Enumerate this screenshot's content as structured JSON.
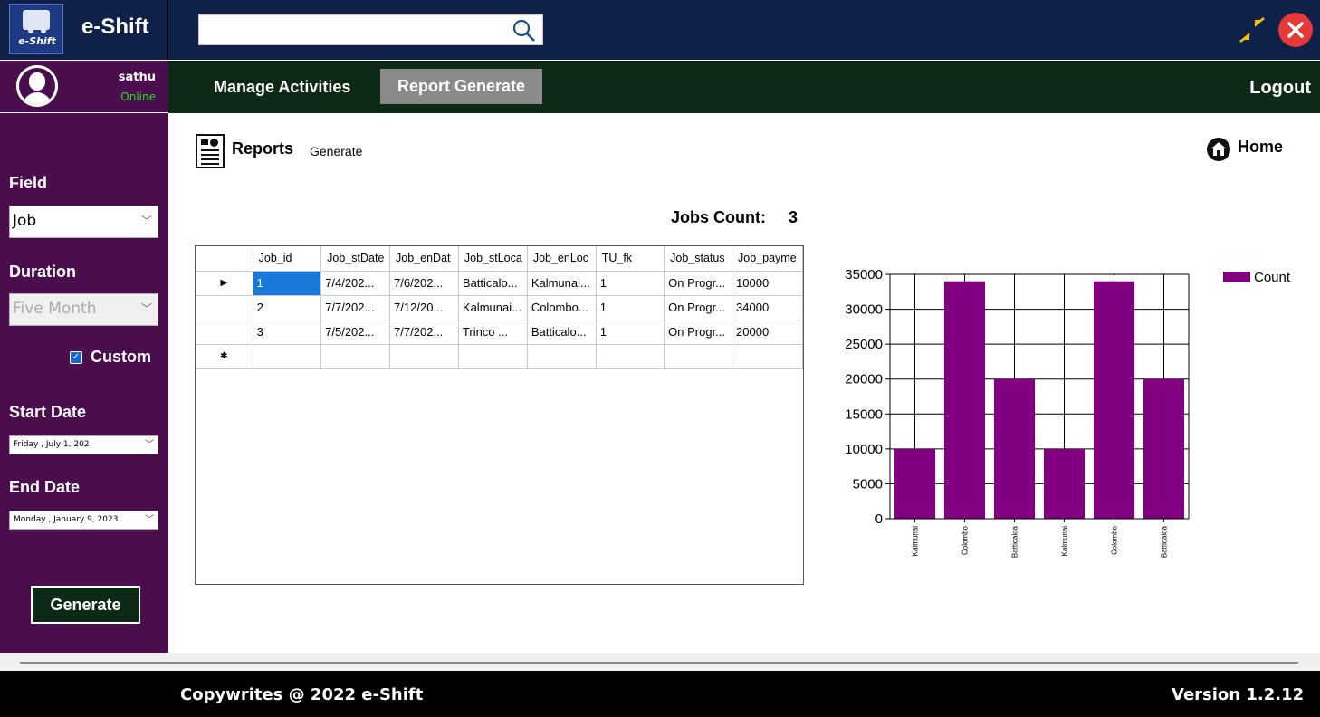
{
  "app": {
    "title": "e-Shift",
    "logo_text": "e-Shift"
  },
  "user": {
    "name": "sathu",
    "status": "Online"
  },
  "nav": {
    "manage": "Manage Activities",
    "report": "Report Generate",
    "logout": "Logout"
  },
  "sidebar": {
    "field_label": "Field",
    "field_value": "Job",
    "duration_label": "Duration",
    "duration_value": "Five Month",
    "custom_label": "Custom",
    "custom_checked": true,
    "start_label": "Start Date",
    "start_value": "Friday   ,     July        1, 202",
    "end_label": "End Date",
    "end_value": "Monday  ,   January    9, 2023",
    "generate": "Generate"
  },
  "page": {
    "title": "Reports",
    "subtitle": "Generate",
    "home": "Home",
    "jobs_count_label": "Jobs Count:",
    "jobs_count_value": "3"
  },
  "grid": {
    "columns": [
      "Job_id",
      "Job_stDate",
      "Job_enDat",
      "Job_stLoca",
      "Job_enLoc",
      "TU_fk",
      "Job_status",
      "Job_payme"
    ],
    "rows": [
      [
        "1",
        "7/4/202...",
        "7/6/202...",
        "Batticalo...",
        "Kalmunai...",
        "1",
        "On Progr...",
        "10000"
      ],
      [
        "2",
        "7/7/202...",
        "7/12/20...",
        "Kalmunai...",
        "Colombo...",
        "1",
        "On Progr...",
        "34000"
      ],
      [
        "3",
        "7/5/202...",
        "7/7/202...",
        "Trinco     ...",
        "Batticalo...",
        "1",
        "On Progr...",
        "20000"
      ]
    ]
  },
  "chart_data": {
    "type": "bar",
    "categories": [
      "Kalmunai",
      "Colombo",
      "Batticaloa",
      "Kalmunai",
      "Colombo",
      "Batticaloa"
    ],
    "series": [
      {
        "name": "Count",
        "values": [
          10000,
          34000,
          20000,
          10000,
          34000,
          20000
        ],
        "color": "#800080"
      }
    ],
    "yticks": [
      "35000",
      "30000",
      "25000",
      "20000",
      "15000",
      "10000",
      "5000",
      "0"
    ],
    "ylim": [
      0,
      35000
    ],
    "grid": true,
    "legend": "top-right"
  },
  "footer": {
    "copyright": "Copywrites  @  2022  e-Shift",
    "version": "Version  1.2.12"
  },
  "colors": {
    "topbar": "#0f2148",
    "sidebar": "#4a0e4e",
    "navbar": "#0c2a16",
    "bar": "#800080",
    "close": "#e63a3a"
  }
}
